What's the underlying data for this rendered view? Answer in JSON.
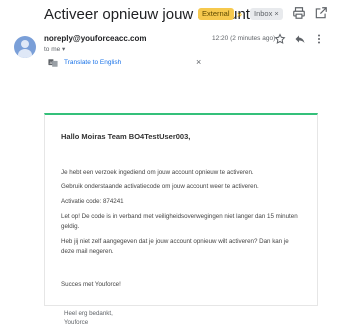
{
  "header": {
    "subject": "Activeer opnieuw jouw account",
    "badge_external": "External",
    "badge_inbox": "Inbox ×"
  },
  "message": {
    "sender": "noreply@youforceacc.com",
    "to": "to me ▾",
    "time": "12:20 (2 minutes ago)"
  },
  "translate": {
    "label": "Translate to English",
    "close": "×"
  },
  "body": {
    "greeting": "Hallo Moiras Team BO4TestUser003,",
    "para1": "Je hebt een verzoek ingediend om jouw account opnieuw te activeren.",
    "para2": "Gebruik onderstaande activatiecode om jouw account weer te activeren.",
    "code_line": "Activatie code: 874241",
    "para3": "Let op! De code is in verband met veiligheidsoverwegingen niet langer dan 15 minuten geldig.",
    "para4": "Heb jij niet zelf aangegeven dat je jouw account opnieuw wilt activeren? Dan kan je deze mail negeren.",
    "closing": "Succes met Youforce!"
  },
  "footer": {
    "line1": "Heel erg bedankt,",
    "line2": "Youforce"
  },
  "colors": {
    "accent_green": "#34c07a",
    "link_blue": "#1a73e8",
    "external_badge": "#f6c94e"
  },
  "icons": [
    "print-icon",
    "open-in-new-icon",
    "avatar-icon",
    "star-icon",
    "reply-icon",
    "more-vert-icon",
    "translate-icon",
    "close-icon"
  ]
}
